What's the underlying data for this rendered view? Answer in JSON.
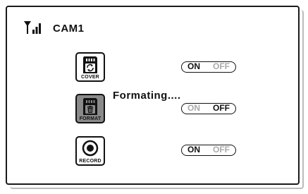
{
  "header": {
    "signal_icon": "signal-strength-icon",
    "camera_name": "CAM1"
  },
  "items": [
    {
      "icon": "sd-card-cover-icon",
      "label": "COVER",
      "toggle": {
        "on": "ON",
        "off": "OFF",
        "state": "on"
      }
    },
    {
      "icon": "sd-card-format-icon",
      "label": "FORMAT",
      "toggle": {
        "on": "ON",
        "off": "OFF",
        "state": "off"
      }
    },
    {
      "icon": "record-icon",
      "label": "RECORD",
      "toggle": {
        "on": "ON",
        "off": "OFF",
        "state": "on"
      }
    }
  ],
  "status_message": "Formating....",
  "colors": {
    "text": "#111111",
    "inactive": "#aaaaaa",
    "selected_icon_bg": "#8a8a8a"
  }
}
